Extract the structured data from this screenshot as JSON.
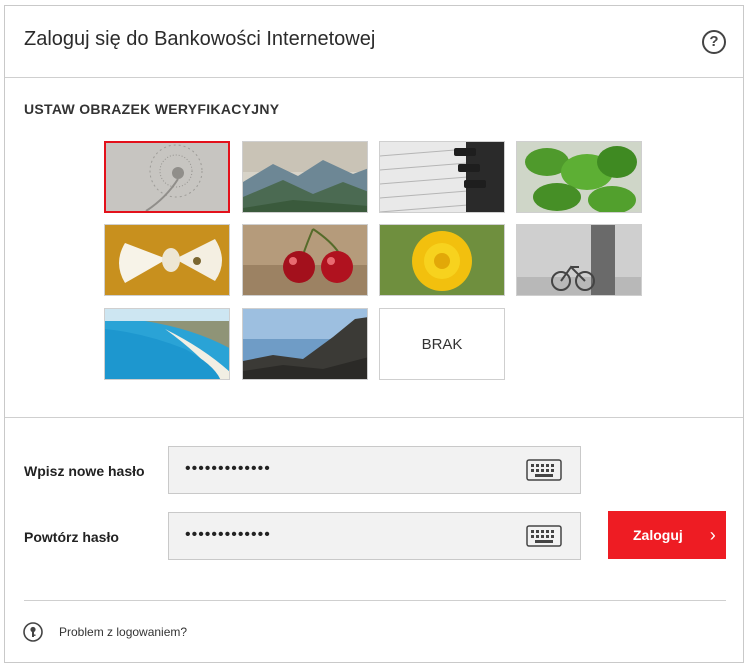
{
  "header": {
    "title": "Zaloguj się do Bankowości Internetowej",
    "help_symbol": "?"
  },
  "image_section": {
    "title": "USTAW OBRAZEK WERYFIKACYJNY",
    "images": [
      {
        "name": "dandelion-seeds",
        "selected": true
      },
      {
        "name": "mountains",
        "selected": false
      },
      {
        "name": "piano-keys",
        "selected": false
      },
      {
        "name": "basil-leaves",
        "selected": false
      },
      {
        "name": "bow-tie",
        "selected": false
      },
      {
        "name": "cherries",
        "selected": false
      },
      {
        "name": "dandelion-flower",
        "selected": false
      },
      {
        "name": "bicycle-tree",
        "selected": false
      },
      {
        "name": "beach",
        "selected": false
      },
      {
        "name": "coastline-rocks",
        "selected": false
      }
    ],
    "none_label": "BRAK"
  },
  "form": {
    "new_password_label": "Wpisz nowe hasło",
    "new_password_value": "•••••••••••••",
    "repeat_password_label": "Powtórz hasło",
    "repeat_password_value": "•••••••••••••",
    "login_label": "Zaloguj",
    "login_arrow": "›"
  },
  "footer": {
    "problem_link": "Problem z logowaniem?"
  },
  "colors": {
    "accent": "#ee1c23",
    "selected_border": "#e3111b",
    "field_bg": "#f2f2f2"
  }
}
